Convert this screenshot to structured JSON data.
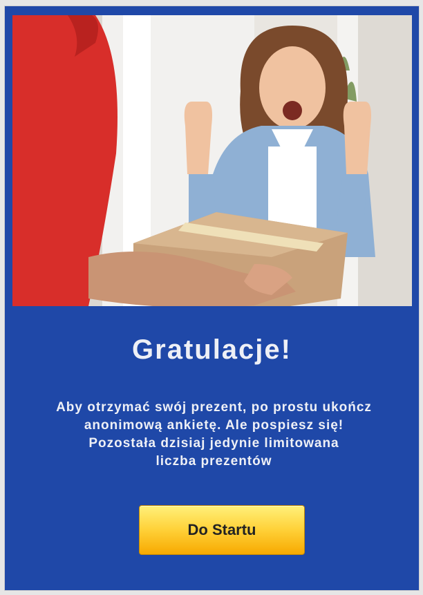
{
  "hero_image": {
    "icon": "delivery-photo"
  },
  "title": "Gratulacje!",
  "message_lines": [
    "Aby otrzymać swój prezent, po prostu ukończ",
    "anonimową ankietę. Ale pospiesz się!",
    "Pozostała dzisiaj jedynie limitowana",
    "liczba prezentów"
  ],
  "start_button_label": "Do Startu",
  "colors": {
    "panel_background": "#1f48a8",
    "text": "#eef0f6",
    "button_top": "#fff07a",
    "button_bottom": "#f7a900"
  }
}
